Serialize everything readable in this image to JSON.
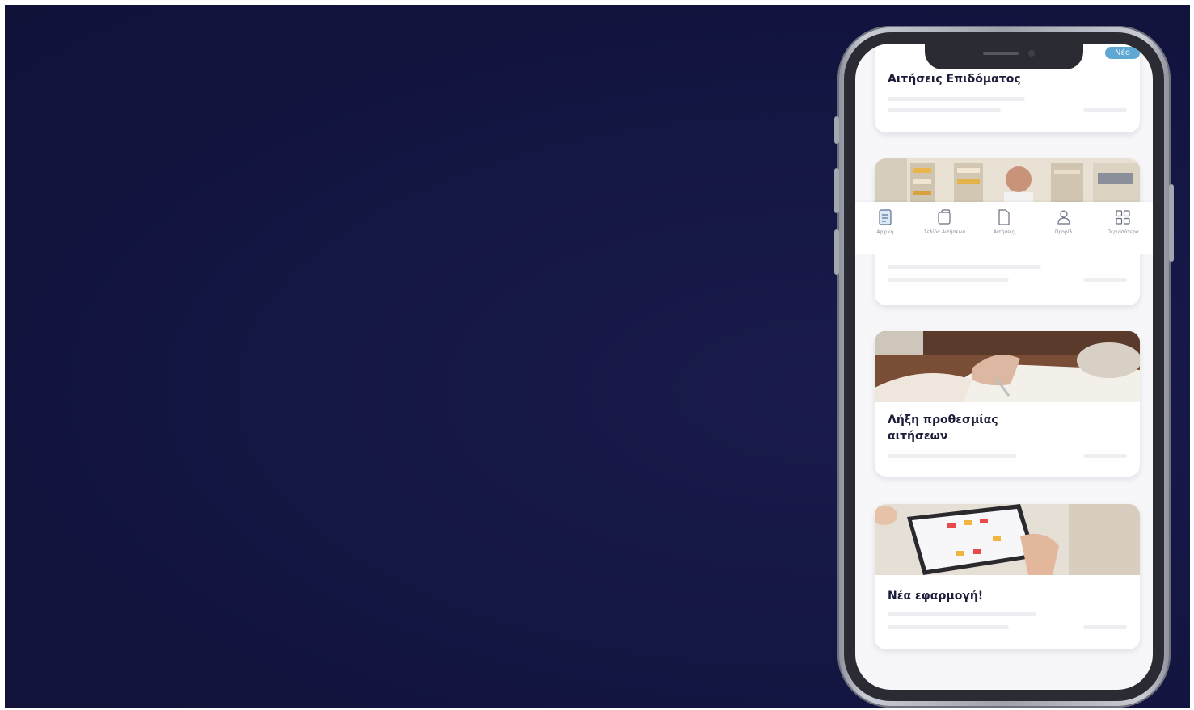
{
  "phone": {
    "badge": "Νέο"
  },
  "cards": [
    {
      "title": "Αιτήσεις Επιδόματος"
    },
    {
      "title": ""
    },
    {
      "title": "Λήξη προθεσμίας αιτήσεων"
    },
    {
      "title": "Νέα εφαρμογή!"
    }
  ],
  "bottom_nav": {
    "items": [
      {
        "label": "Αρχική",
        "icon": "document-icon"
      },
      {
        "label": "Σελίδα Αιτήσεων",
        "icon": "folder-icon"
      },
      {
        "label": "Αιτήσεις",
        "icon": "file-icon"
      },
      {
        "label": "Προφίλ",
        "icon": "user-icon"
      },
      {
        "label": "Περισσότερα",
        "icon": "grid-icon"
      }
    ]
  },
  "colors": {
    "background": "#141644",
    "accent": "#5fa8d3",
    "title_text": "#1b1d3a"
  }
}
